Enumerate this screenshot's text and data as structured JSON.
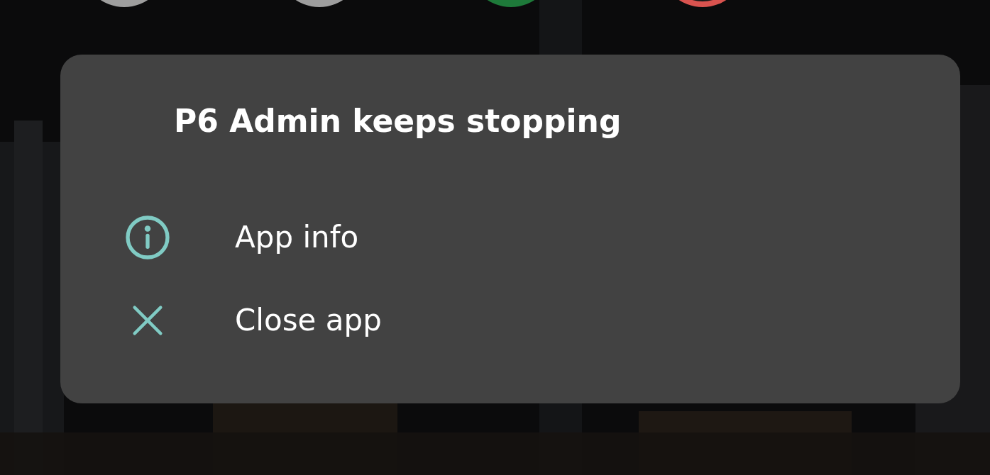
{
  "dialog": {
    "title": "P6 Admin keeps stopping",
    "actions": [
      {
        "kind": "info",
        "label": "App info"
      },
      {
        "kind": "close",
        "label": "Close app"
      }
    ]
  }
}
